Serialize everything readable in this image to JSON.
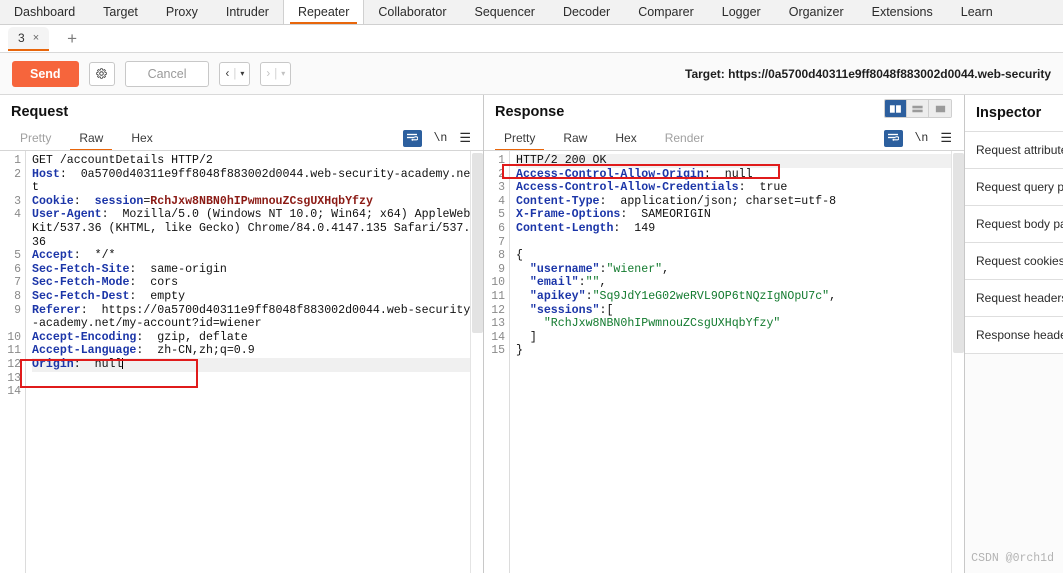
{
  "main_tabs": [
    {
      "label": "Dashboard",
      "active": false
    },
    {
      "label": "Target",
      "active": false
    },
    {
      "label": "Proxy",
      "active": false
    },
    {
      "label": "Intruder",
      "active": false
    },
    {
      "label": "Repeater",
      "active": true
    },
    {
      "label": "Collaborator",
      "active": false
    },
    {
      "label": "Sequencer",
      "active": false
    },
    {
      "label": "Decoder",
      "active": false
    },
    {
      "label": "Comparer",
      "active": false
    },
    {
      "label": "Logger",
      "active": false
    },
    {
      "label": "Organizer",
      "active": false
    },
    {
      "label": "Extensions",
      "active": false
    },
    {
      "label": "Learn",
      "active": false
    }
  ],
  "session_bar": {
    "tab_label": "3",
    "close_label": "×",
    "add_label": "+"
  },
  "toolbar": {
    "send_label": "Send",
    "settings_icon": "gear-icon",
    "cancel_label": "Cancel",
    "back_label": "‹",
    "forward_label": "›",
    "caret": "▾",
    "target_text": "Target: https://0a5700d40311e9ff8048f883002d0044.web-security"
  },
  "request": {
    "title": "Request",
    "tabs": [
      {
        "label": "Pretty",
        "active": false,
        "muted": true
      },
      {
        "label": "Raw",
        "active": true,
        "muted": false
      },
      {
        "label": "Hex",
        "active": false,
        "muted": false
      }
    ],
    "actions": {
      "wrap_icon": "word-wrap-icon",
      "newline_label": "\\n",
      "menu_icon": "hamburger-menu-icon"
    },
    "line_numbers": [
      "1",
      "2",
      "3",
      "4",
      "",
      "",
      "5",
      "6",
      "7",
      "8",
      "9",
      "",
      "",
      "10",
      "11",
      "12",
      "13",
      "14"
    ],
    "lines": [
      {
        "n": "1",
        "seg": [
          {
            "t": "GET /accountDetails HTTP/2",
            "c": "val"
          }
        ]
      },
      {
        "n": "2",
        "seg": [
          {
            "t": "Host",
            "c": "hdr"
          },
          {
            "t": ":  0a5700d40311e9ff8048f883002d0044.web-security-academy.net",
            "c": "val"
          }
        ]
      },
      {
        "n": "3",
        "seg": [
          {
            "t": "Cookie",
            "c": "hdr"
          },
          {
            "t": ":  ",
            "c": "val"
          },
          {
            "t": "session",
            "c": "bluev"
          },
          {
            "t": "=",
            "c": "val"
          },
          {
            "t": "RchJxw8NBN0hIPwmnouZCsgUXHqbYfzy",
            "c": "redv"
          }
        ]
      },
      {
        "n": "4",
        "seg": [
          {
            "t": "User-Agent",
            "c": "hdr"
          },
          {
            "t": ":  Mozilla/5.0 (Windows NT 10.0; Win64; x64) AppleWebKit/537.36 (KHTML, like Gecko) Chrome/84.0.4147.135 Safari/537.36",
            "c": "val"
          }
        ]
      },
      {
        "n": "5",
        "seg": [
          {
            "t": "Accept",
            "c": "hdr"
          },
          {
            "t": ":  */*",
            "c": "val"
          }
        ]
      },
      {
        "n": "6",
        "seg": [
          {
            "t": "Sec-Fetch-Site",
            "c": "hdr"
          },
          {
            "t": ":  same-origin",
            "c": "val"
          }
        ]
      },
      {
        "n": "7",
        "seg": [
          {
            "t": "Sec-Fetch-Mode",
            "c": "hdr"
          },
          {
            "t": ":  cors",
            "c": "val"
          }
        ]
      },
      {
        "n": "8",
        "seg": [
          {
            "t": "Sec-Fetch-Dest",
            "c": "hdr"
          },
          {
            "t": ":  empty",
            "c": "val"
          }
        ]
      },
      {
        "n": "9",
        "seg": [
          {
            "t": "Referer",
            "c": "hdr"
          },
          {
            "t": ":  https://0a5700d40311e9ff8048f883002d0044.web-security-academy.net/my-account?id=wiener",
            "c": "val"
          }
        ]
      },
      {
        "n": "10",
        "seg": [
          {
            "t": "Accept-Encoding",
            "c": "hdr"
          },
          {
            "t": ":  gzip, deflate",
            "c": "val"
          }
        ]
      },
      {
        "n": "11",
        "seg": [
          {
            "t": "Accept-Language",
            "c": "hdr"
          },
          {
            "t": ":  zh-CN,zh;q=0.9",
            "c": "val"
          }
        ]
      },
      {
        "n": "12",
        "seg": [
          {
            "t": "Origin",
            "c": "hdr"
          },
          {
            "t": ":  null",
            "c": "val"
          }
        ],
        "highlight": true,
        "caret": true
      },
      {
        "n": "13",
        "seg": []
      },
      {
        "n": "14",
        "seg": []
      }
    ],
    "annotation": {
      "label": "origin-null-highlight",
      "color": "#e01b1b"
    }
  },
  "response": {
    "title": "Response",
    "tabs": [
      {
        "label": "Pretty",
        "active": true,
        "muted": false
      },
      {
        "label": "Raw",
        "active": false,
        "muted": false
      },
      {
        "label": "Hex",
        "active": false,
        "muted": false
      },
      {
        "label": "Render",
        "active": false,
        "muted": true
      }
    ],
    "actions": {
      "wrap_icon": "word-wrap-icon",
      "newline_label": "\\n",
      "menu_icon": "hamburger-menu-icon"
    },
    "layout_buttons": [
      {
        "name": "side-by-side-layout",
        "active": true
      },
      {
        "name": "stacked-layout",
        "active": false
      },
      {
        "name": "single-pane-layout",
        "active": false
      }
    ],
    "lines": [
      {
        "n": "1",
        "seg": [
          {
            "t": "HTTP/2 200 OK",
            "c": "val"
          }
        ],
        "highlight": true
      },
      {
        "n": "2",
        "seg": [
          {
            "t": "Access-Control-Allow-Origin",
            "c": "hdr"
          },
          {
            "t": ":  null",
            "c": "val"
          }
        ]
      },
      {
        "n": "3",
        "seg": [
          {
            "t": "Access-Control-Allow-Credentials",
            "c": "hdr"
          },
          {
            "t": ":  true",
            "c": "val"
          }
        ]
      },
      {
        "n": "4",
        "seg": [
          {
            "t": "Content-Type",
            "c": "hdr"
          },
          {
            "t": ":  application/json; charset=utf-8",
            "c": "val"
          }
        ]
      },
      {
        "n": "5",
        "seg": [
          {
            "t": "X-Frame-Options",
            "c": "hdr"
          },
          {
            "t": ":  SAMEORIGIN",
            "c": "val"
          }
        ]
      },
      {
        "n": "6",
        "seg": [
          {
            "t": "Content-Length",
            "c": "hdr"
          },
          {
            "t": ":  149",
            "c": "val"
          }
        ]
      },
      {
        "n": "7",
        "seg": []
      },
      {
        "n": "8",
        "seg": [
          {
            "t": "{",
            "c": "val"
          }
        ]
      },
      {
        "n": "9",
        "seg": [
          {
            "t": "  ",
            "c": "val"
          },
          {
            "t": "\"username\"",
            "c": "jkey"
          },
          {
            "t": ":",
            "c": "val"
          },
          {
            "t": "\"wiener\"",
            "c": "greenv"
          },
          {
            "t": ",",
            "c": "val"
          }
        ]
      },
      {
        "n": "10",
        "seg": [
          {
            "t": "  ",
            "c": "val"
          },
          {
            "t": "\"email\"",
            "c": "jkey"
          },
          {
            "t": ":",
            "c": "val"
          },
          {
            "t": "\"\"",
            "c": "greenv"
          },
          {
            "t": ",",
            "c": "val"
          }
        ]
      },
      {
        "n": "11",
        "seg": [
          {
            "t": "  ",
            "c": "val"
          },
          {
            "t": "\"apikey\"",
            "c": "jkey"
          },
          {
            "t": ":",
            "c": "val"
          },
          {
            "t": "\"Sq9JdY1eG02weRVL9OP6tNQzIgNOpU7c\"",
            "c": "greenv"
          },
          {
            "t": ",",
            "c": "val"
          }
        ]
      },
      {
        "n": "12",
        "seg": [
          {
            "t": "  ",
            "c": "val"
          },
          {
            "t": "\"sessions\"",
            "c": "jkey"
          },
          {
            "t": ":[",
            "c": "val"
          }
        ]
      },
      {
        "n": "13",
        "seg": [
          {
            "t": "    ",
            "c": "val"
          },
          {
            "t": "\"RchJxw8NBN0hIPwmnouZCsgUXHqbYfzy\"",
            "c": "greenv"
          }
        ]
      },
      {
        "n": "14",
        "seg": [
          {
            "t": "  ]",
            "c": "val"
          }
        ]
      },
      {
        "n": "15",
        "seg": [
          {
            "t": "}",
            "c": "val"
          }
        ]
      }
    ],
    "annotation": {
      "label": "acao-null-highlight",
      "color": "#e01b1b"
    }
  },
  "inspector": {
    "title": "Inspector",
    "items": [
      {
        "label": "Request attributes"
      },
      {
        "label": "Request query parameters"
      },
      {
        "label": "Request body parameters"
      },
      {
        "label": "Request cookies"
      },
      {
        "label": "Request headers"
      },
      {
        "label": "Response headers"
      }
    ]
  },
  "watermark": "CSDN @0rch1d"
}
